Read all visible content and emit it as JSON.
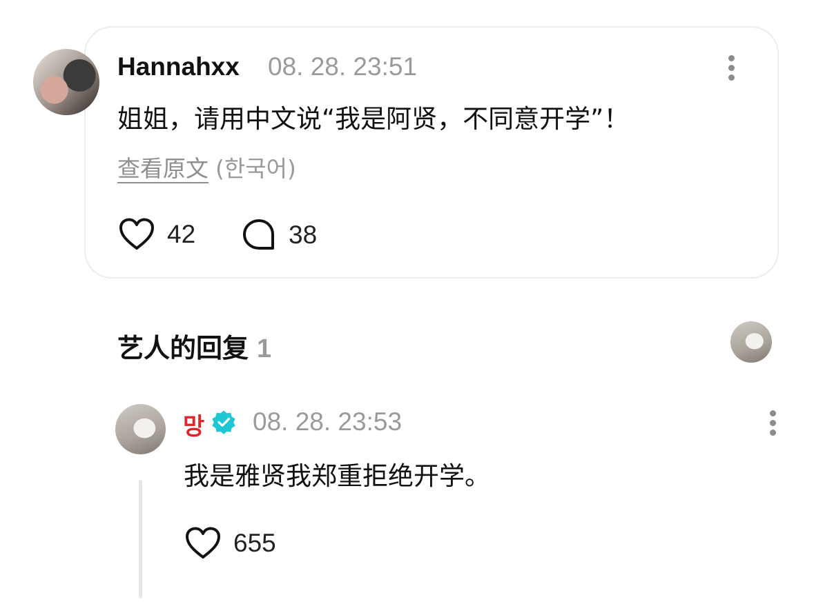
{
  "comment": {
    "username": "Hannahxx",
    "timestamp": "08. 28. 23:51",
    "text": "姐姐，请用中文说“我是阿贤，不同意开学”！",
    "translate_link": "查看原文",
    "original_language": "(한국어)",
    "like_count": "42",
    "reply_count": "38"
  },
  "artist_replies": {
    "title": "艺人的回复",
    "count": "1"
  },
  "reply": {
    "author": "망",
    "timestamp": "08. 28. 23:53",
    "text": "我是雅贤我郑重拒绝开学。",
    "like_count": "655"
  },
  "colors": {
    "artist_name": "#e0242b",
    "verified_badge": "#1fc7d4",
    "muted_text": "#9a9a9a"
  },
  "icons": [
    "heart-icon",
    "comment-bubble-icon",
    "more-vertical-icon",
    "verified-badge-icon"
  ]
}
